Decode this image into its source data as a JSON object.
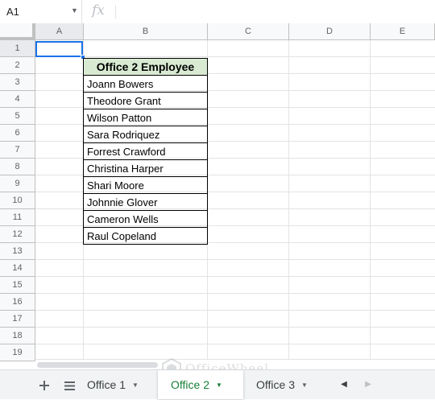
{
  "formula_bar": {
    "name_box": "A1",
    "fx_label": "fx",
    "formula_value": ""
  },
  "columns": [
    "A",
    "B",
    "C",
    "D",
    "E"
  ],
  "rows": [
    "1",
    "2",
    "3",
    "4",
    "5",
    "6",
    "7",
    "8",
    "9",
    "10",
    "11",
    "12",
    "13",
    "14",
    "15",
    "16",
    "17",
    "18",
    "19"
  ],
  "table": {
    "header": "Office 2 Employee",
    "employees": [
      "Joann Bowers",
      "Theodore Grant",
      "Wilson Patton",
      "Sara Rodriquez",
      "Forrest Crawford",
      "Christina Harper",
      "Shari Moore",
      "Johnnie Glover",
      "Cameron Wells",
      "Raul Copeland"
    ]
  },
  "sheet_tabs": {
    "add_icon": "plus-icon",
    "list_icon": "menu-list-icon",
    "tabs": [
      {
        "label": "Office 1",
        "active": false
      },
      {
        "label": "Office 2",
        "active": true
      },
      {
        "label": "Office 3",
        "active": false
      }
    ]
  },
  "watermark": "OfficeWheel",
  "colors": {
    "header_fill": "#d9ead3",
    "active_tab": "#188038",
    "selection": "#1a73e8"
  }
}
